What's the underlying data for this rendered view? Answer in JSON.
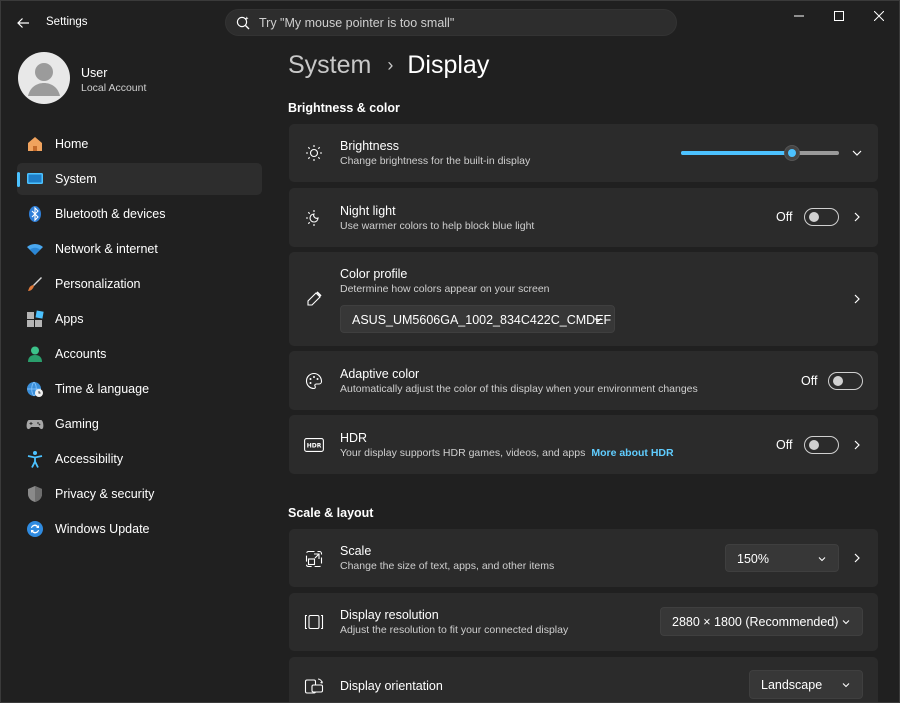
{
  "app": {
    "title": "Settings"
  },
  "search": {
    "placeholder": "Try \"My mouse pointer is too small\""
  },
  "user": {
    "name": "User",
    "account_type": "Local Account"
  },
  "nav": {
    "items": [
      {
        "label": "Home",
        "icon": "home-icon",
        "active": false
      },
      {
        "label": "System",
        "icon": "system-icon",
        "active": true
      },
      {
        "label": "Bluetooth & devices",
        "icon": "bluetooth-icon",
        "active": false
      },
      {
        "label": "Network & internet",
        "icon": "wifi-icon",
        "active": false
      },
      {
        "label": "Personalization",
        "icon": "brush-icon",
        "active": false
      },
      {
        "label": "Apps",
        "icon": "apps-icon",
        "active": false
      },
      {
        "label": "Accounts",
        "icon": "accounts-icon",
        "active": false
      },
      {
        "label": "Time & language",
        "icon": "globe-clock-icon",
        "active": false
      },
      {
        "label": "Gaming",
        "icon": "gamepad-icon",
        "active": false
      },
      {
        "label": "Accessibility",
        "icon": "accessibility-icon",
        "active": false
      },
      {
        "label": "Privacy & security",
        "icon": "shield-icon",
        "active": false
      },
      {
        "label": "Windows Update",
        "icon": "update-icon",
        "active": false
      }
    ]
  },
  "breadcrumb": {
    "parent": "System",
    "current": "Display"
  },
  "sections": {
    "brightness_color": "Brightness & color",
    "scale_layout": "Scale & layout"
  },
  "settings": {
    "brightness": {
      "title": "Brightness",
      "subtitle": "Change brightness for the built-in display",
      "value_fraction": 0.7
    },
    "night_light": {
      "title": "Night light",
      "subtitle": "Use warmer colors to help block blue light",
      "state": "Off"
    },
    "color_profile": {
      "title": "Color profile",
      "subtitle": "Determine how colors appear on your screen",
      "selected": "ASUS_UM5606GA_1002_834C422C_CMDEF"
    },
    "adaptive_color": {
      "title": "Adaptive color",
      "subtitle": "Automatically adjust the color of this display when your environment changes",
      "state": "Off"
    },
    "hdr": {
      "title": "HDR",
      "subtitle": "Your display supports HDR games, videos, and apps",
      "link": "More about HDR",
      "state": "Off"
    },
    "scale": {
      "title": "Scale",
      "subtitle": "Change the size of text, apps, and other items",
      "selected": "150%"
    },
    "display_resolution": {
      "title": "Display resolution",
      "subtitle": "Adjust the resolution to fit your connected display",
      "selected": "2880 × 1800 (Recommended)"
    },
    "display_orientation": {
      "title": "Display orientation",
      "selected": "Landscape"
    }
  },
  "colors": {
    "accent": "#4cc2ff",
    "link": "#60cdff",
    "background": "#202020",
    "card": "#2b2b2b"
  }
}
